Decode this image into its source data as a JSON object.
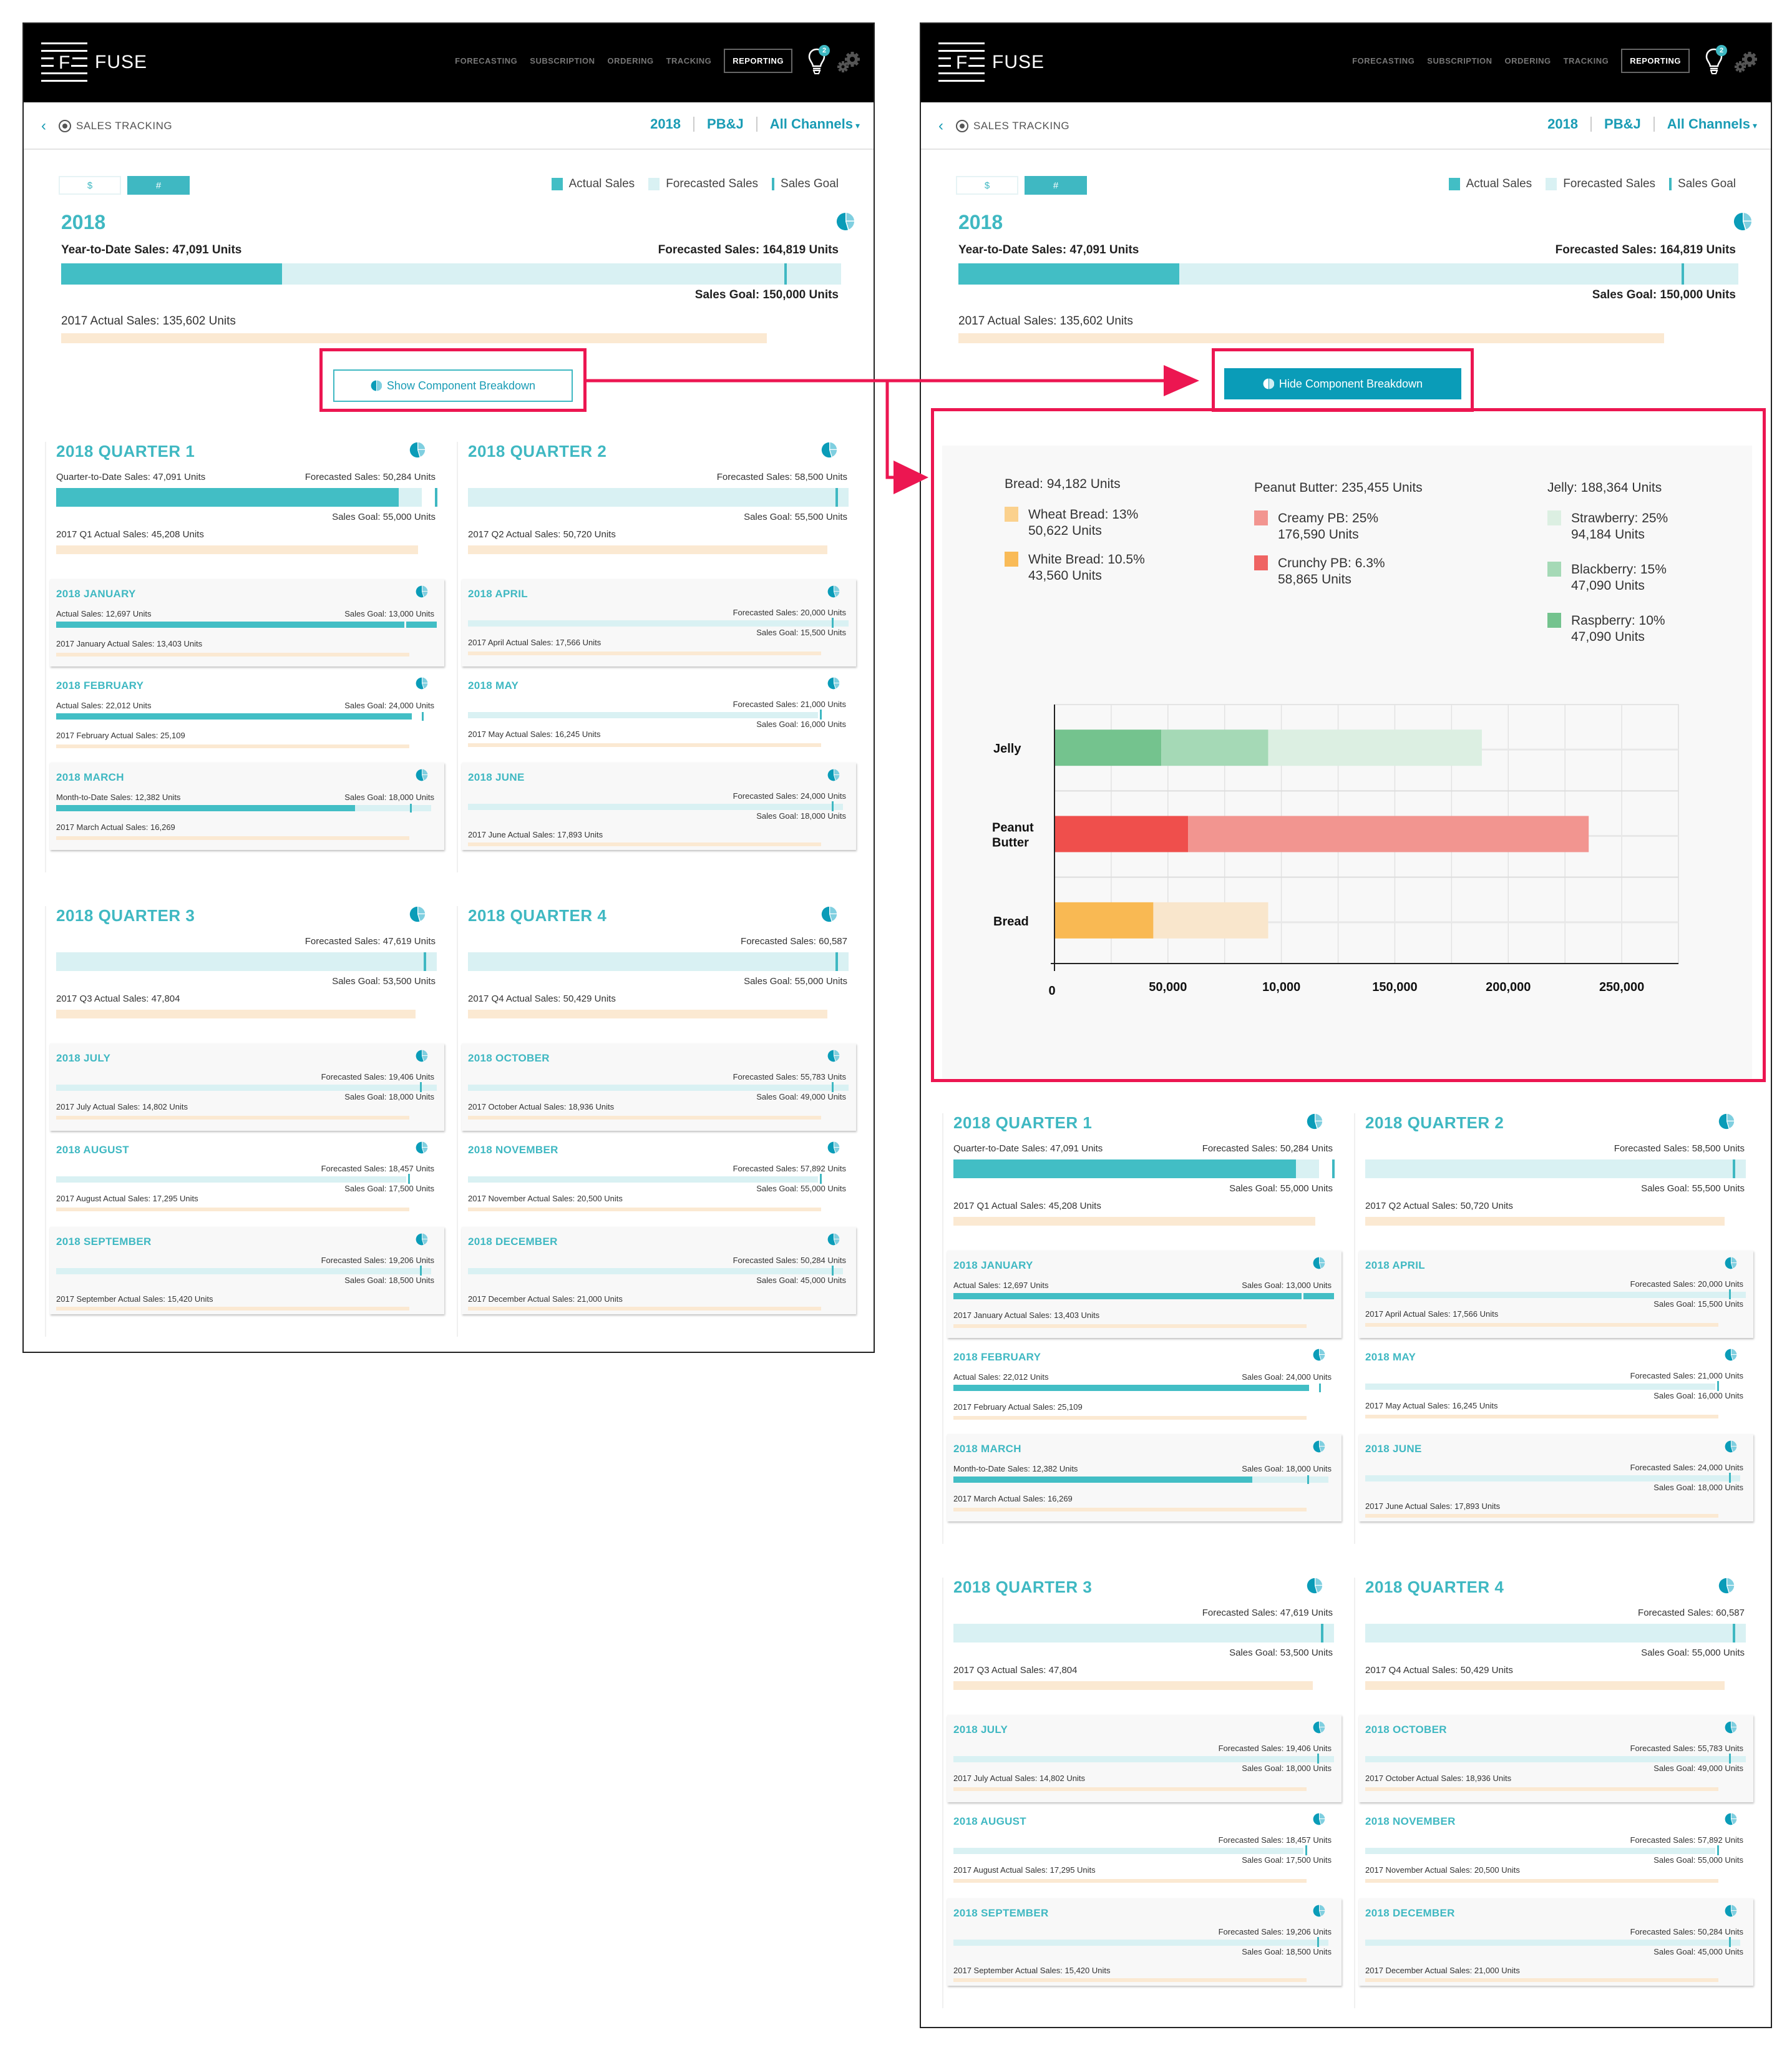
{
  "nav": {
    "brand": "FUSE",
    "logo_letter": "F",
    "links": [
      "FORECASTING",
      "SUBSCRIPTION",
      "ORDERING",
      "TRACKING",
      "REPORTING"
    ],
    "active": "REPORTING",
    "notification_count": "2",
    "icons": [
      "lightbulb-icon",
      "gear-icon"
    ]
  },
  "subheader": {
    "back_icon": "chevron-left-icon",
    "section_icon": "target-icon",
    "title": "SALES TRACKING",
    "filters": {
      "year": "2018",
      "product": "PB&J",
      "channel": "All Channels"
    },
    "caret": "▾"
  },
  "summary": {
    "toggle": {
      "dollar": "$",
      "units": "#",
      "selected": "#"
    },
    "legend": {
      "actual": "Actual Sales",
      "forecast": "Forecasted Sales",
      "goal": "Sales Goal"
    },
    "year": "2018",
    "ytd": "Year-to-Date Sales: 47,091 Units",
    "forecast": "Forecasted Sales: 164,819 Units",
    "goal": "Sales Goal: 150,000 Units",
    "prev": "2017 Actual Sales: 135,602 Units",
    "actual_value": 47091,
    "forecast_value": 164819,
    "goal_value": 150000,
    "prev_value": 135602
  },
  "buttons": {
    "show": "Show Component Breakdown",
    "hide": "Hide Component Breakdown"
  },
  "colors": {
    "accent": "#3fb8c2",
    "actual": "#42bec5",
    "forecast": "#d9f1f3",
    "prev_year": "#fbe9d2",
    "button_active": "#0a9cb8",
    "callout": "#ec1651"
  },
  "quarters": [
    {
      "title": "2018 QUARTER 1",
      "left_label": "Quarter-to-Date Sales: 47,091 Units",
      "right_label": "Forecasted Sales: 50,284 Units",
      "goal_label": "Sales Goal: 55,000 Units",
      "prev_label": "2017 Q1 Actual Sales: 45,208 Units",
      "actual_frac": 0.9,
      "forecast_frac": 0.96,
      "goal_frac": 0.995,
      "prev_frac": 0.95,
      "months": [
        {
          "title": "2018 JANUARY",
          "left": "Actual Sales: 12,697 Units",
          "right": "Sales Goal: 13,000 Units",
          "goal": "",
          "prev": "2017 January Actual Sales: 13,403 Units",
          "actual_frac": 1.0,
          "forecast_frac": 1.0,
          "goal_frac": 0.915,
          "layout": "actual",
          "shaded": true
        },
        {
          "title": "2018 FEBRUARY",
          "left": "Actual Sales: 22,012 Units",
          "right": "Sales Goal: 24,000 Units",
          "goal": "",
          "prev": "2017 February Actual Sales: 25,109",
          "actual_frac": 0.935,
          "forecast_frac": 0.935,
          "goal_frac": 0.96,
          "layout": "actual",
          "shaded": false
        },
        {
          "title": "2018 MARCH",
          "left": "Month-to-Date Sales: 12,382 Units",
          "right": "Sales Goal: 18,000 Units",
          "goal": "",
          "prev": "2017 March Actual Sales: 16,269",
          "actual_frac": 0.785,
          "forecast_frac": 0.985,
          "goal_frac": 0.93,
          "layout": "actual",
          "shaded": true
        }
      ]
    },
    {
      "title": "2018 QUARTER 2",
      "left_label": "",
      "right_label": "Forecasted Sales: 58,500 Units",
      "goal_label": "Sales Goal: 55,500 Units",
      "prev_label": "2017 Q2 Actual Sales: 50,720 Units",
      "actual_frac": 0,
      "forecast_frac": 1.0,
      "goal_frac": 0.965,
      "prev_frac": 0.945,
      "months": [
        {
          "title": "2018 APRIL",
          "left": "",
          "right": "Forecasted Sales: 20,000 Units",
          "goal": "Sales Goal: 15,500 Units",
          "prev": "2017 April Actual Sales: 17,566 Units",
          "actual_frac": 0,
          "forecast_frac": 1.0,
          "goal_frac": 0.955,
          "layout": "forecast",
          "shaded": true
        },
        {
          "title": "2018 MAY",
          "left": "",
          "right": "Forecasted Sales: 21,000 Units",
          "goal": "Sales Goal: 16,000 Units",
          "prev": "2017 May Actual Sales: 16,245 Units",
          "actual_frac": 0,
          "forecast_frac": 0.92,
          "goal_frac": 0.925,
          "layout": "forecast",
          "shaded": false
        },
        {
          "title": "2018 JUNE",
          "left": "",
          "right": "Forecasted Sales: 24,000 Units",
          "goal": "Sales Goal: 18,000 Units",
          "prev": "2017 June Actual Sales: 17,893 Units",
          "actual_frac": 0,
          "forecast_frac": 0.985,
          "goal_frac": 0.955,
          "layout": "forecast",
          "shaded": true
        }
      ]
    },
    {
      "title": "2018 QUARTER 3",
      "left_label": "",
      "right_label": "Forecasted Sales: 47,619 Units",
      "goal_label": "Sales Goal: 53,500 Units",
      "prev_label": "2017 Q3 Actual Sales: 47,804",
      "actual_frac": 0,
      "forecast_frac": 1.0,
      "goal_frac": 0.965,
      "prev_frac": 0.945,
      "months": [
        {
          "title": "2018 JULY",
          "left": "",
          "right": "Forecasted Sales: 19,406 Units",
          "goal": "Sales Goal: 18,000 Units",
          "prev": "2017 July Actual Sales: 14,802 Units",
          "actual_frac": 0,
          "forecast_frac": 1.0,
          "goal_frac": 0.955,
          "layout": "forecast",
          "shaded": true
        },
        {
          "title": "2018 AUGUST",
          "left": "",
          "right": "Forecasted Sales: 18,457 Units",
          "goal": "Sales Goal: 17,500 Units",
          "prev": "2017 August Actual Sales: 17,295 Units",
          "actual_frac": 0,
          "forecast_frac": 0.92,
          "goal_frac": 0.925,
          "layout": "forecast",
          "shaded": false
        },
        {
          "title": "2018 SEPTEMBER",
          "left": "",
          "right": "Forecasted Sales: 19,206 Units",
          "goal": "Sales Goal: 18,500 Units",
          "prev": "2017 September Actual Sales: 15,420 Units",
          "actual_frac": 0,
          "forecast_frac": 0.985,
          "goal_frac": 0.955,
          "layout": "forecast",
          "shaded": true
        }
      ]
    },
    {
      "title": "2018 QUARTER 4",
      "left_label": "",
      "right_label": "Forecasted Sales: 60,587",
      "goal_label": "Sales Goal: 55,000 Units",
      "prev_label": "2017 Q4 Actual Sales: 50,429 Units",
      "actual_frac": 0,
      "forecast_frac": 1.0,
      "goal_frac": 0.965,
      "prev_frac": 0.945,
      "months": [
        {
          "title": "2018 OCTOBER",
          "left": "",
          "right": "Forecasted Sales: 55,783 Units",
          "goal": "Sales Goal: 49,000 Units",
          "prev": "2017 October Actual Sales: 18,936 Units",
          "actual_frac": 0,
          "forecast_frac": 1.0,
          "goal_frac": 0.955,
          "layout": "forecast",
          "shaded": true
        },
        {
          "title": "2018 NOVEMBER",
          "left": "",
          "right": "Forecasted Sales: 57,892 Units",
          "goal": "Sales Goal: 55,000 Units",
          "prev": "2017 November Actual Sales: 20,500 Units",
          "actual_frac": 0,
          "forecast_frac": 0.92,
          "goal_frac": 0.925,
          "layout": "forecast",
          "shaded": false
        },
        {
          "title": "2018 DECEMBER",
          "left": "",
          "right": "Forecasted Sales: 50,284 Units",
          "goal": "Sales Goal: 45,000 Units",
          "prev": "2017 December Actual Sales: 21,000 Units",
          "actual_frac": 0,
          "forecast_frac": 0.985,
          "goal_frac": 0.955,
          "layout": "forecast",
          "shaded": true
        }
      ]
    }
  ],
  "breakdown": {
    "groups": [
      {
        "header": "Bread: 94,182 Units",
        "items": [
          {
            "label": "Wheat Bread: 13%",
            "units": "50,622 Units",
            "color": "#fbd18d"
          },
          {
            "label": "White Bread: 10.5%",
            "units": "43,560 Units",
            "color": "#f9bb58"
          }
        ]
      },
      {
        "header": "Peanut Butter: 235,455 Units",
        "items": [
          {
            "label": "Creamy PB: 25%",
            "units": "176,590 Units",
            "color": "#f29590"
          },
          {
            "label": "Crunchy PB: 6.3%",
            "units": "58,865 Units",
            "color": "#ef6463"
          }
        ]
      },
      {
        "header": "Jelly: 188,364 Units",
        "items": [
          {
            "label": "Strawberry: 25%",
            "units": "94,184 Units",
            "color": "#dcefe2"
          },
          {
            "label": "Blackberry: 15%",
            "units": "47,090 Units",
            "color": "#a5d9b6"
          },
          {
            "label": "Raspberry: 10%",
            "units": "47,090 Units",
            "color": "#74c38e"
          }
        ]
      }
    ]
  },
  "chart_data": {
    "type": "bar",
    "orientation": "horizontal",
    "stacked": true,
    "title": "",
    "xlabel": "",
    "ylabel": "",
    "categories": [
      "Jelly",
      "Peanut Butter",
      "Bread"
    ],
    "category_lines": [
      [
        "Jelly"
      ],
      [
        "Peanut",
        "Butter"
      ],
      [
        "Bread"
      ]
    ],
    "series": [
      {
        "category": "Jelly",
        "segments": [
          {
            "name": "Raspberry",
            "value": 47090,
            "color": "#74c38e"
          },
          {
            "name": "Blackberry",
            "value": 47090,
            "color": "#a5d9b6"
          },
          {
            "name": "Strawberry",
            "value": 94184,
            "color": "#dcefe2"
          }
        ]
      },
      {
        "category": "Peanut Butter",
        "segments": [
          {
            "name": "Crunchy PB",
            "value": 58865,
            "color": "#ef4f4c"
          },
          {
            "name": "Creamy PB",
            "value": 176590,
            "color": "#f29590"
          }
        ]
      },
      {
        "category": "Bread",
        "segments": [
          {
            "name": "White Bread",
            "value": 43560,
            "color": "#f9b953"
          },
          {
            "name": "Wheat Bread",
            "value": 50622,
            "color": "#f9e6cc"
          }
        ]
      }
    ],
    "xlim": [
      0,
      275000
    ],
    "xticks": [
      0,
      50000,
      100000,
      150000,
      200000,
      250000
    ],
    "xtick_labels": [
      "0",
      "50,000",
      "10,000",
      "150,000",
      "200,000",
      "250,000"
    ],
    "grid": true,
    "legend": "top"
  }
}
